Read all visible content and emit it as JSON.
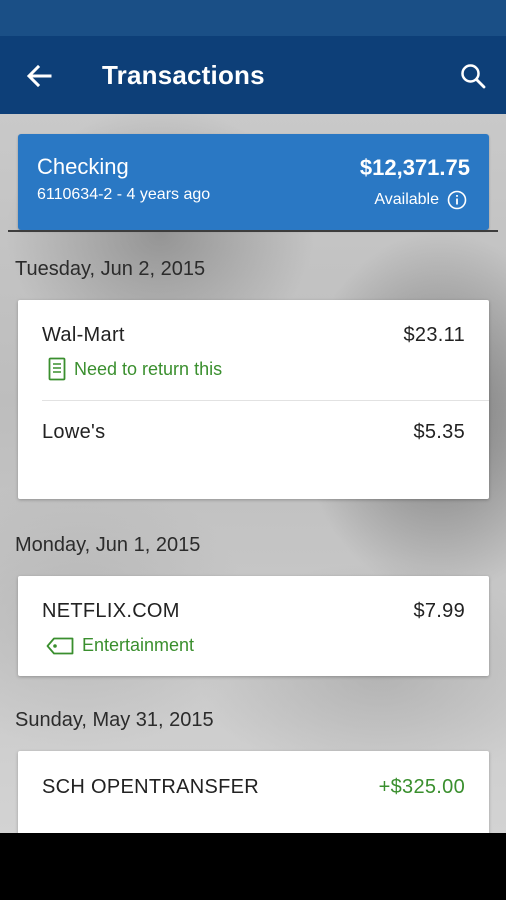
{
  "header": {
    "title": "Transactions",
    "back_icon": "arrow-left-icon",
    "search_icon": "search-icon"
  },
  "account": {
    "name": "Checking",
    "subtitle": "6110634-2 - 4 years ago",
    "balance": "$12,371.75",
    "balance_label": "Available",
    "info_icon": "info-icon"
  },
  "groups": [
    {
      "date": "Tuesday, Jun 2, 2015",
      "transactions": [
        {
          "merchant": "Wal-Mart",
          "amount": "$23.11",
          "note": "Need to return this",
          "note_icon": "receipt-icon"
        },
        {
          "merchant": "Lowe's",
          "amount": "$5.35"
        }
      ]
    },
    {
      "date": "Monday, Jun 1, 2015",
      "transactions": [
        {
          "merchant": "NETFLIX.COM",
          "amount": "$7.99",
          "note": "Entertainment",
          "note_icon": "tag-icon"
        }
      ]
    },
    {
      "date": "Sunday, May 31, 2015",
      "transactions": [
        {
          "merchant": "SCH OPENTRANSFER",
          "amount": "+$325.00"
        }
      ]
    }
  ],
  "colors": {
    "app_bar": "#0d3f78",
    "status_bar": "#1a4f86",
    "account_card": "#2a78c4",
    "positive": "#3a8f2e"
  }
}
